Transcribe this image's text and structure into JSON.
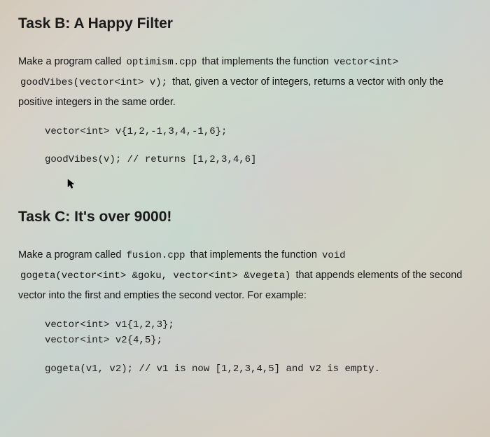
{
  "taskB": {
    "heading": "Task B: A Happy Filter",
    "desc_part1": "Make a program called ",
    "code1": "optimism.cpp",
    "desc_part2": " that implements the function ",
    "code2": "vector<int>",
    "desc_line2_code": "goodVibes(vector<int> v);",
    "desc_line2_rest": " that, given a vector of integers, returns a vector with only the",
    "desc_line3": "positive integers in the same order.",
    "codeblock1": "vector<int> v{1,2,-1,3,4,-1,6};",
    "codeblock2": "goodVibes(v); // returns [1,2,3,4,6]",
    "cursor": "↖"
  },
  "taskC": {
    "heading": "Task C: It's over 9000!",
    "desc_part1": "Make a program called ",
    "code1": "fusion.cpp",
    "desc_part2": " that implements the function ",
    "code2": "void",
    "desc_line2_code": "gogeta(vector<int> &goku, vector<int> &vegeta)",
    "desc_line2_rest": " that appends elements of the second",
    "desc_line3": "vector into the first and empties the second vector. For example:",
    "codeblock1": "vector<int> v1{1,2,3};\nvector<int> v2{4,5};",
    "codeblock2": "gogeta(v1, v2); // v1 is now [1,2,3,4,5] and v2 is empty."
  }
}
